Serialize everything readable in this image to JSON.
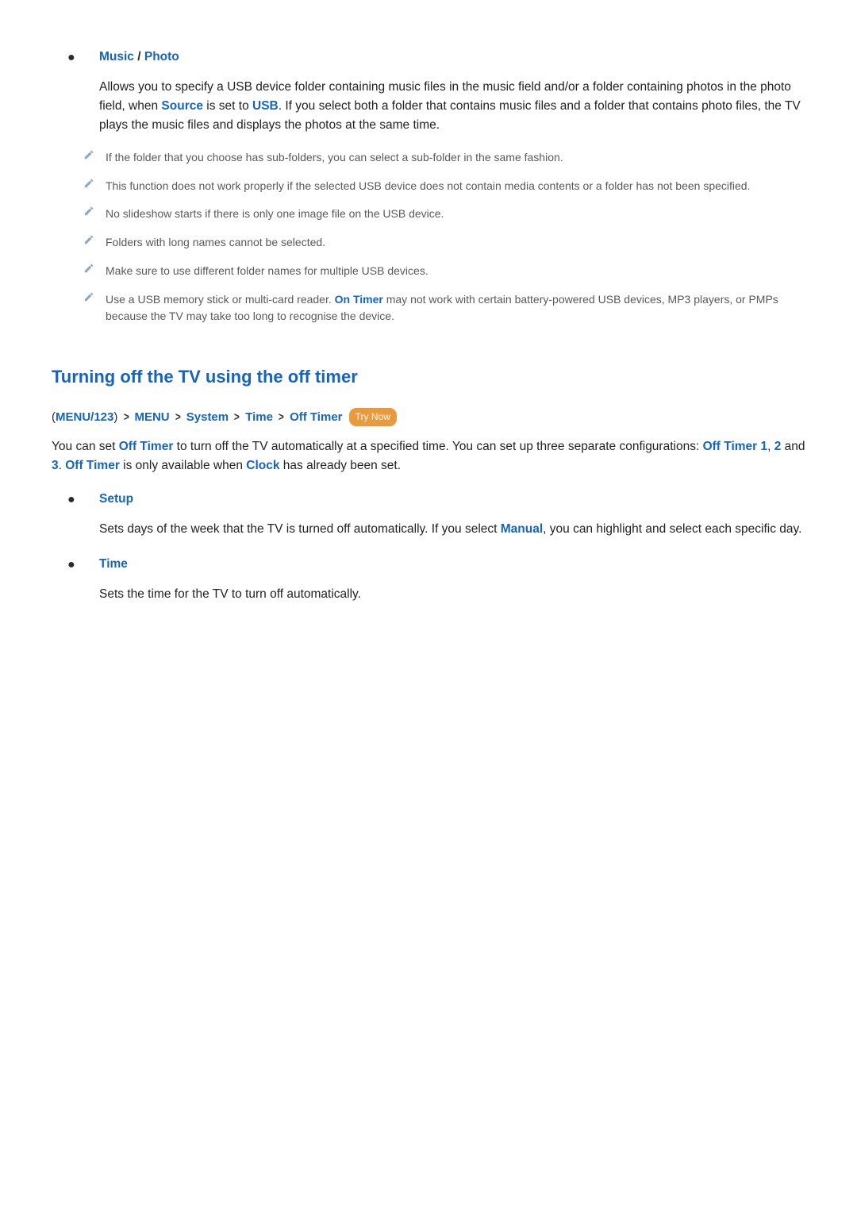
{
  "musicPhoto": {
    "music_label": "Music",
    "slash": " / ",
    "photo_label": "Photo",
    "desc_prefix": "Allows you to specify a USB device folder containing music files in the music field and/or a folder containing photos in the photo field, when ",
    "source_label": "Source",
    "desc_mid1": " is set to ",
    "usb_label": "USB",
    "desc_suffix": ". If you select both a folder that contains music files and a folder that contains photo files, the TV plays the music files and displays the photos at the same time.",
    "notes": {
      "n1": "If the folder that you choose has sub-folders, you can select a sub-folder in the same fashion.",
      "n2": "This function does not work properly if the selected USB device does not contain media contents or a folder has not been specified.",
      "n3": "No slideshow starts if there is only one image file on the USB device.",
      "n4": "Folders with long names cannot be selected.",
      "n5": "Make sure to use different folder names for multiple USB devices.",
      "n6_pre": "Use a USB memory stick or multi-card reader. ",
      "n6_on_timer": "On Timer",
      "n6_post": " may not work with certain battery-powered USB devices, MP3 players, or PMPs because the TV may take too long to recognise the device."
    }
  },
  "offTimerSection": {
    "heading": "Turning off the TV using the off timer",
    "bc": {
      "open": "(",
      "menu123": "MENU/123",
      "close": ")",
      "menu": "MENU",
      "system": "System",
      "time": "Time",
      "off_timer": "Off Timer",
      "chev": ">",
      "trynow": "Try Now"
    },
    "intro": {
      "p1": "You can set ",
      "off_timer": "Off Timer",
      "p2": " to turn off the TV automatically at a specified time. You can set up three separate configurations: ",
      "off_timer_1": "Off Timer 1",
      "comma1": ", ",
      "n2": "2",
      "and": " and ",
      "n3": "3",
      "period1": ". ",
      "off_timer2": "Off Timer",
      "p3": " is only available when ",
      "clock": "Clock",
      "p4": " has already been set."
    },
    "setup": {
      "label": "Setup",
      "desc_pre": "Sets days of the week that the TV is turned off automatically. If you select ",
      "manual": "Manual",
      "desc_post": ", you can highlight and select each specific day."
    },
    "time": {
      "label": "Time",
      "desc": "Sets the time for the TV to turn off automatically."
    }
  }
}
